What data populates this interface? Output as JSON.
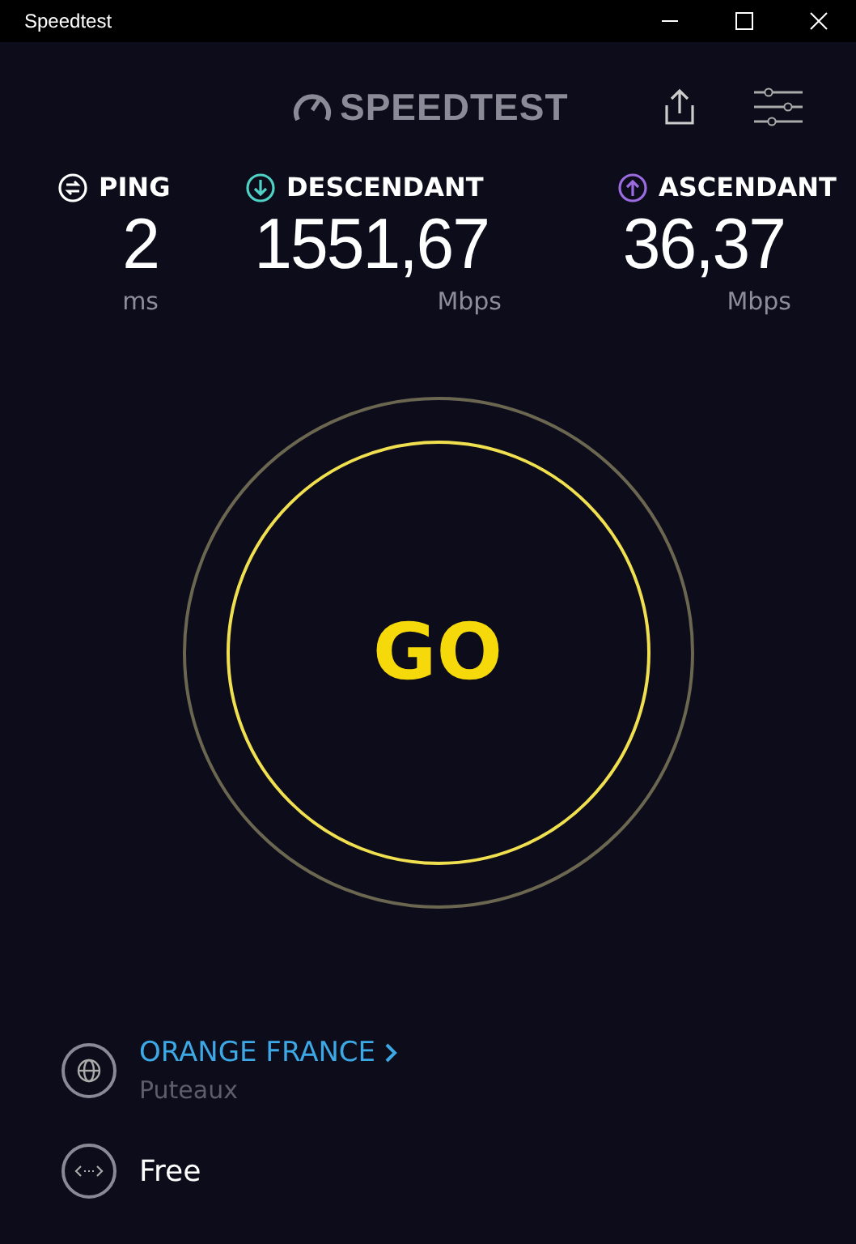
{
  "window": {
    "title": "Speedtest"
  },
  "header": {
    "logo": "SPEEDTEST"
  },
  "metrics": [
    {
      "kind": "ping",
      "label": "PING",
      "value": "2",
      "unit": "ms"
    },
    {
      "kind": "download",
      "label": "DESCENDANT",
      "value": "1551,67",
      "unit": "Mbps"
    },
    {
      "kind": "upload",
      "label": "ASCENDANT",
      "value": "36,37",
      "unit": "Mbps"
    }
  ],
  "go_button": {
    "label": "GO"
  },
  "provider": {
    "name": "ORANGE FRANCE",
    "location": "Puteaux"
  },
  "server": {
    "name": "Free"
  }
}
